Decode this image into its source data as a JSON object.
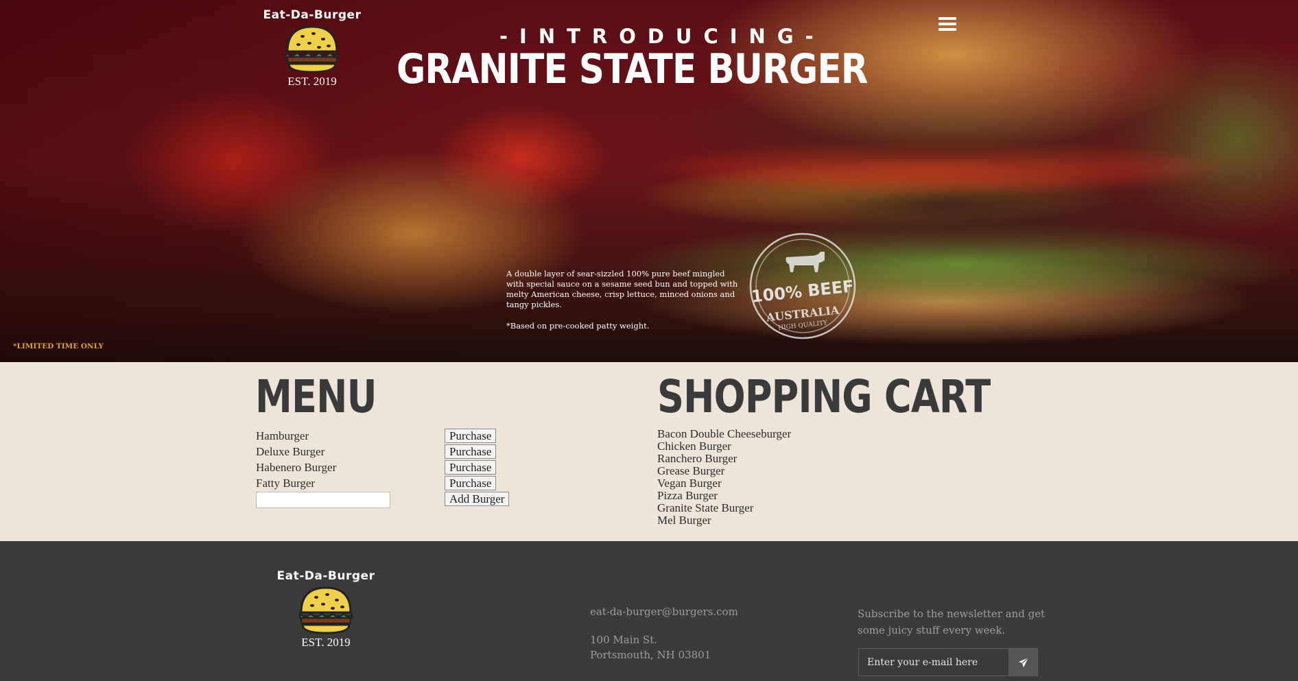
{
  "brand": {
    "name": "Eat-Da-Burger",
    "established": "EST. 2019"
  },
  "hero": {
    "kicker": "-INTRODUCING-",
    "title": "GRANITE STATE BURGER",
    "description": "A double layer of sear-sizzled 100% pure beef mingled with special sauce on a sesame seed bun and topped with melty American cheese, crisp lettuce, minced onions and tangy pickles.",
    "note": "*Based on pre-cooked patty weight.",
    "limited": "*LIMITED TIME ONLY",
    "stamp": {
      "main": "100% BEEF",
      "country": "AUSTRALIA",
      "quality": "HIGH QUALITY"
    }
  },
  "menu": {
    "title": "MENU",
    "items": [
      {
        "name": "Hamburger",
        "action": "Purchase"
      },
      {
        "name": "Deluxe Burger",
        "action": "Purchase"
      },
      {
        "name": "Habenero Burger",
        "action": "Purchase"
      },
      {
        "name": "Fatty Burger",
        "action": "Purchase"
      }
    ],
    "new_burger_value": "",
    "add_label": "Add Burger"
  },
  "cart": {
    "title": "SHOPPING CART",
    "items": [
      "Bacon Double Cheeseburger",
      "Chicken Burger",
      "Ranchero Burger",
      "Grease Burger",
      "Vegan Burger",
      "Pizza Burger",
      "Granite State Burger",
      "Mel Burger"
    ]
  },
  "footer": {
    "email": "eat-da-burger@burgers.com",
    "address_line1": "100 Main St.",
    "address_line2": "Portsmouth, NH 03801",
    "newsletter_text": "Subscribe to the newsletter and get some juicy stuff every week.",
    "newsletter_placeholder": "Enter your e-mail here"
  },
  "icons": {
    "menu": "hamburger-menu-icon",
    "logo": "burger-icon",
    "send": "paper-plane-icon"
  },
  "colors": {
    "accent": "#e0a238",
    "page_bg": "#ede5d9",
    "footer_bg": "#3b3b3b",
    "heading": "#3a3a3a"
  }
}
